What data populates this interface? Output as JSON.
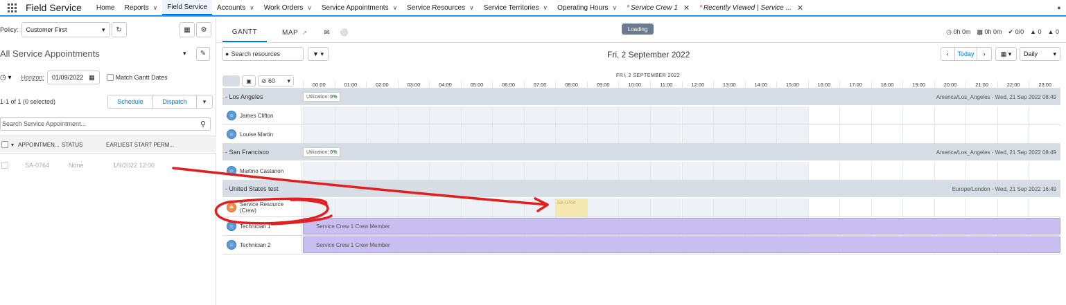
{
  "nav": {
    "app_name": "Field Service",
    "items": [
      {
        "label": "Home",
        "chevron": false,
        "active": false,
        "tab": false
      },
      {
        "label": "Reports",
        "chevron": true,
        "active": false,
        "tab": false
      },
      {
        "label": "Field Service",
        "chevron": false,
        "active": true,
        "tab": false
      },
      {
        "label": "Accounts",
        "chevron": true,
        "active": false,
        "tab": false
      },
      {
        "label": "Work Orders",
        "chevron": true,
        "active": false,
        "tab": false
      },
      {
        "label": "Service Appointments",
        "chevron": true,
        "active": false,
        "tab": false
      },
      {
        "label": "Service Resources",
        "chevron": true,
        "active": false,
        "tab": false
      },
      {
        "label": "Service Territories",
        "chevron": true,
        "active": false,
        "tab": false
      },
      {
        "label": "Operating Hours",
        "chevron": true,
        "active": false,
        "tab": false
      }
    ],
    "open_tabs": [
      {
        "label": "Service Crew 1"
      },
      {
        "label": "Recently Viewed | Service ..."
      }
    ]
  },
  "left": {
    "policy_label": "Policy:",
    "policy_value": "Customer First",
    "list_title": "All Service Appointments",
    "horizon_label": "Horizon:",
    "horizon_date": "01/09/2022",
    "match_gantt_label": "Match Gantt Dates",
    "selection_count": "1-1 of 1 (0 selected)",
    "schedule_label": "Schedule",
    "dispatch_label": "Dispatch",
    "search_placeholder": "Search Service Appointment...",
    "columns": [
      "APPOINTMEN...",
      "STATUS",
      "EARLIEST START PERM..."
    ],
    "rows": [
      {
        "id": "SA-0764",
        "status": "None",
        "earliest": "1/9/2022 12:00"
      }
    ]
  },
  "right": {
    "tabs": {
      "gantt": "GANTT",
      "map": "MAP"
    },
    "loading": "Loading",
    "counters": [
      "0h 0m",
      "0h 0m",
      "0/0",
      "0",
      "0"
    ],
    "resource_search_placeholder": "Search resources",
    "date_title": "Fri, 2 September 2022",
    "today_label": "Today",
    "view_value": "Daily",
    "gantt": {
      "date_header": "FRI, 2 SEPTEMBER 2022",
      "interval_value": "60",
      "hours": [
        "00:00",
        "01:00",
        "02:00",
        "03:00",
        "04:00",
        "05:00",
        "06:00",
        "07:00",
        "08:00",
        "09:00",
        "10:00",
        "11:00",
        "12:00",
        "13:00",
        "14:00",
        "15:00",
        "16:00",
        "17:00",
        "18:00",
        "19:00",
        "20:00",
        "21:00",
        "22:00",
        "23:00"
      ],
      "groups": [
        {
          "name": "- Los Angeles",
          "utilization_label": "Utilization:",
          "utilization": "0%",
          "timezone": "America/Los_Angeles - Wed, 21 Sep 2022 08:49",
          "resources": [
            {
              "name": "James Clifton",
              "crew": false
            },
            {
              "name": "Louise Martin",
              "crew": false
            }
          ]
        },
        {
          "name": "- San Francisco",
          "utilization_label": "Utilization:",
          "utilization": "0%",
          "timezone": "America/Los_Angeles - Wed, 21 Sep 2022 08:49",
          "resources": [
            {
              "name": "Martino Castanon",
              "crew": false
            }
          ]
        },
        {
          "name": "- United States test",
          "utilization_label": "",
          "utilization": "",
          "timezone": "Europe/London - Wed, 21 Sep 2022 16:49",
          "resources": [
            {
              "name": "Service Resource (Crew)",
              "crew": true,
              "appointment": "SA-0764"
            },
            {
              "name": "Technician 1",
              "crew": false,
              "crew_member": "Service Crew 1 Crew Member"
            },
            {
              "name": "Technician 2",
              "crew": false,
              "crew_member": "Service Crew 1 Crew Member"
            }
          ]
        }
      ]
    }
  },
  "colors": {
    "accent": "#0176d3",
    "group_row": "#d7dde5",
    "crew_bar": "#c8bff0",
    "appointment": "#f5e7b0",
    "annotation": "#e02020"
  }
}
